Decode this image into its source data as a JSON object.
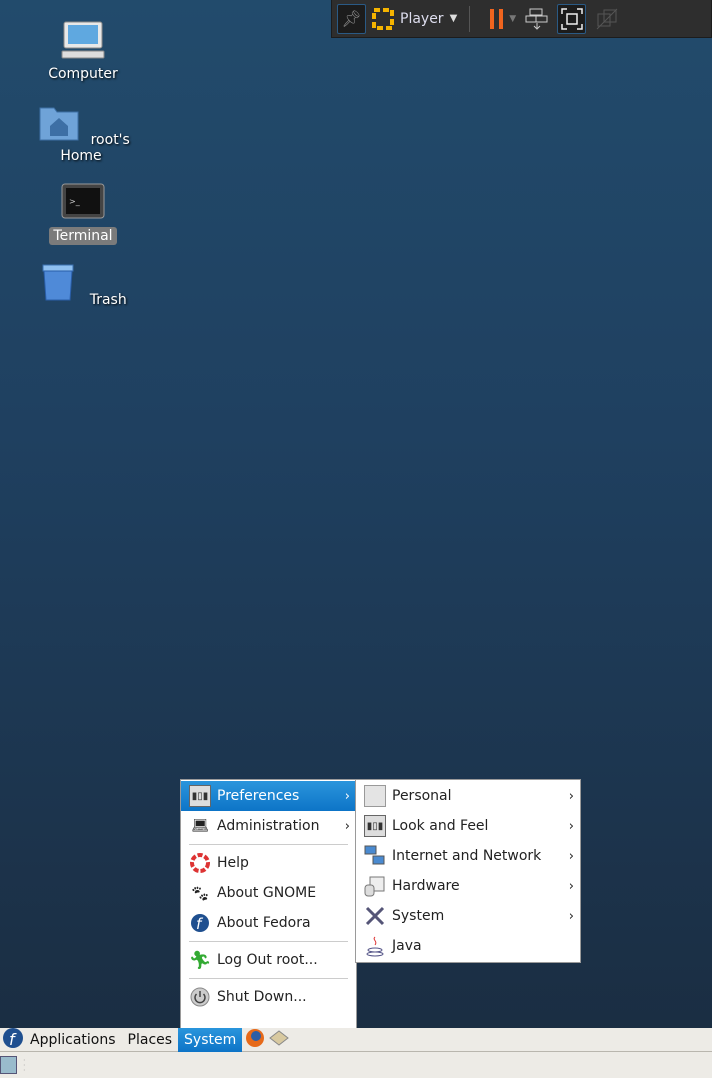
{
  "vm_toolbar": {
    "player_label": "Player",
    "colors": {
      "pause": "#f0641e",
      "logo": "#f5b400"
    }
  },
  "desktop": {
    "icons": [
      {
        "label": "Computer"
      },
      {
        "label": "root's Home"
      },
      {
        "label": "Terminal",
        "selected": true
      },
      {
        "label": "Trash"
      }
    ]
  },
  "system_menu": {
    "items": [
      {
        "label": "Preferences",
        "submenu": true,
        "highlighted": true
      },
      {
        "label": "Administration",
        "submenu": true
      },
      {
        "label": "Help"
      },
      {
        "label": "About GNOME"
      },
      {
        "label": "About Fedora"
      },
      {
        "label": "Log Out root..."
      },
      {
        "label": "Shut Down..."
      }
    ]
  },
  "preferences_submenu": {
    "items": [
      {
        "label": "Personal"
      },
      {
        "label": "Look and Feel"
      },
      {
        "label": "Internet and Network"
      },
      {
        "label": "Hardware"
      },
      {
        "label": "System"
      },
      {
        "label": "Java"
      }
    ]
  },
  "panel": {
    "applications": "Applications",
    "places": "Places",
    "system": "System"
  },
  "arrow": "›"
}
